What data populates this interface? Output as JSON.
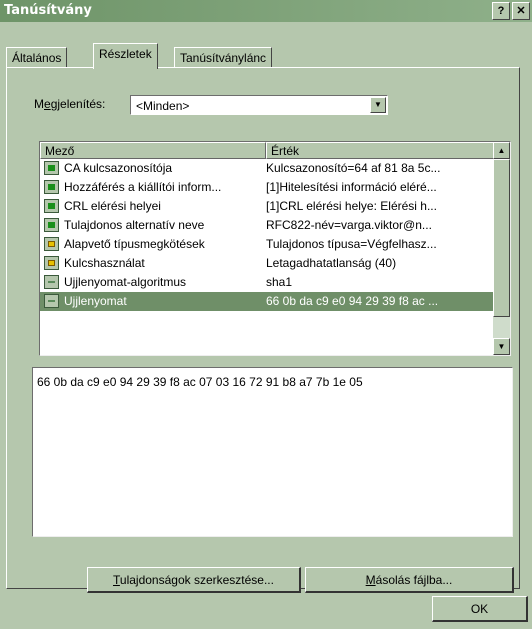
{
  "window": {
    "title": "Tanúsítvány",
    "help_glyph": "?",
    "close_glyph": "✕"
  },
  "tabs": [
    {
      "label": "Általános"
    },
    {
      "label": "Részletek"
    },
    {
      "label": "Tanúsítványlánc"
    }
  ],
  "show": {
    "label_pre": "M",
    "label_u": "e",
    "label_post": "gjelenítés:",
    "value": "<Minden>"
  },
  "list": {
    "headers": {
      "field": "Mező",
      "value": "Érték"
    },
    "rows": [
      {
        "icon": "extension-icon",
        "field": "CA kulcsazonosítója",
        "value": "Kulcsazonosító=64 af 81 8a 5c..."
      },
      {
        "icon": "extension-icon",
        "field": "Hozzáférés a kiállítói inform...",
        "value": "[1]Hitelesítési információ eléré..."
      },
      {
        "icon": "extension-icon",
        "field": "CRL elérési helyei",
        "value": "[1]CRL elérési helye: Elérési h..."
      },
      {
        "icon": "extension-icon",
        "field": "Tulajdonos alternatív neve",
        "value": "RFC822-név=varga.viktor@n..."
      },
      {
        "icon": "critical-extension-icon",
        "field": "Alapvető típusmegkötések",
        "value": "Tulajdonos típusa=Végfelhasz..."
      },
      {
        "icon": "critical-extension-icon",
        "field": "Kulcshasználat",
        "value": "Letagadhatatlanság (40)"
      },
      {
        "icon": "property-icon",
        "field": "Ujjlenyomat-algoritmus",
        "value": "sha1"
      },
      {
        "icon": "property-icon",
        "field": "Ujjlenyomat",
        "value": "66 0b da c9 e0 94 29 39 f8 ac ..."
      }
    ],
    "selected_index": 7
  },
  "detail_text": "66 0b da c9 e0 94 29 39 f8 ac 07 03 16 72 91 b8 a7 7b 1e 05",
  "buttons": {
    "edit_u": "T",
    "edit_rest": "ulajdonságok szerkesztése...",
    "copy_u": "M",
    "copy_rest": "ásolás fájlba...",
    "ok": "OK"
  },
  "colors": {
    "titlebar": "#6e9468",
    "face": "#b5c7ad",
    "selection": "#6f8f68"
  }
}
